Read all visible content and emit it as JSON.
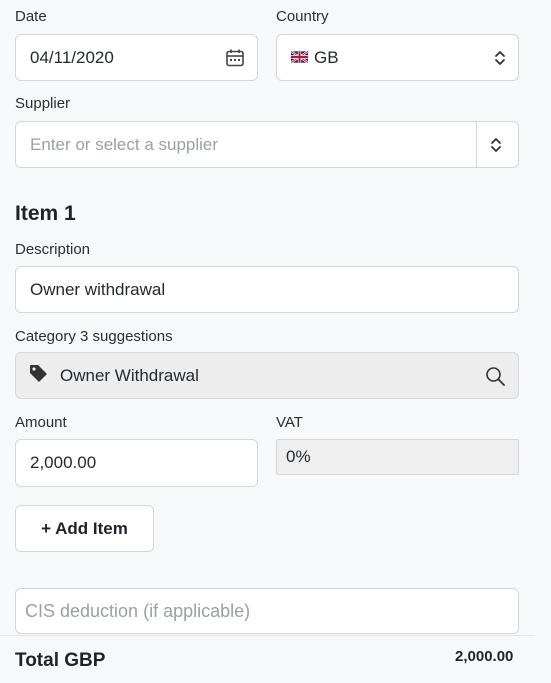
{
  "date": {
    "label": "Date",
    "value": "04/11/2020",
    "icon": "calendar-icon"
  },
  "country": {
    "label": "Country",
    "flag": "uk-flag-icon",
    "value": "GB",
    "icon": "up-down-chevron-icon"
  },
  "supplier": {
    "label": "Supplier",
    "placeholder": "Enter or select a supplier",
    "icon": "up-down-chevron-icon"
  },
  "item": {
    "heading": "Item 1",
    "description": {
      "label": "Description",
      "value": "Owner withdrawal"
    },
    "category": {
      "label": "Category 3 suggestions",
      "value": "Owner Withdrawal",
      "tag_icon": "tag-icon",
      "search_icon": "search-icon"
    },
    "amount": {
      "label": "Amount",
      "value": "2,000.00"
    },
    "vat": {
      "label": "VAT",
      "value": "0%"
    }
  },
  "add_item_label": "+ Add Item",
  "cis": {
    "placeholder": "CIS deduction (if applicable)"
  },
  "total": {
    "label": "Total GBP",
    "value": "2,000.00"
  }
}
